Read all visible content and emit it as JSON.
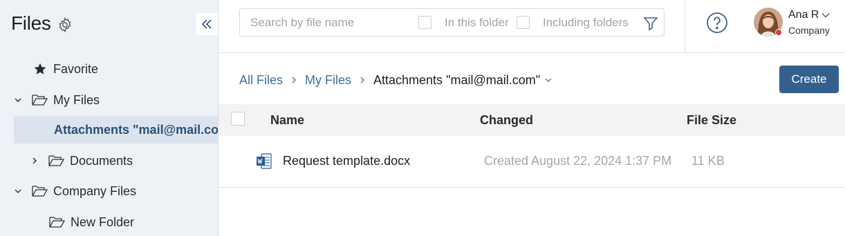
{
  "sidebar": {
    "title": "Files",
    "items": [
      {
        "label": "Favorite"
      },
      {
        "label": "My Files"
      },
      {
        "label": "Attachments \"mail@mail.com\""
      },
      {
        "label": "Documents"
      },
      {
        "label": "Company Files"
      },
      {
        "label": "New Folder"
      }
    ]
  },
  "search": {
    "placeholder": "Search by file name",
    "in_this_folder_label": "In this folder",
    "including_folders_label": "Including folders"
  },
  "user": {
    "name": "Ana R",
    "company": "Company",
    "status_color": "#e0393e"
  },
  "breadcrumb": {
    "items": [
      "All Files",
      "My Files",
      "Attachments \"mail@mail.com\""
    ]
  },
  "toolbar": {
    "create_label": "Create"
  },
  "table": {
    "columns": [
      "Name",
      "Changed",
      "File Size"
    ],
    "rows": [
      {
        "name": "Request template.docx",
        "changed": "Created August 22, 2024 1:37 PM",
        "size": "11 KB",
        "icon": "word-doc-icon"
      }
    ]
  },
  "colors": {
    "accent": "#346090",
    "link": "#3a6ea5",
    "sidebar_bg": "#eef1f6",
    "active_item_bg": "#dbe3ee"
  }
}
